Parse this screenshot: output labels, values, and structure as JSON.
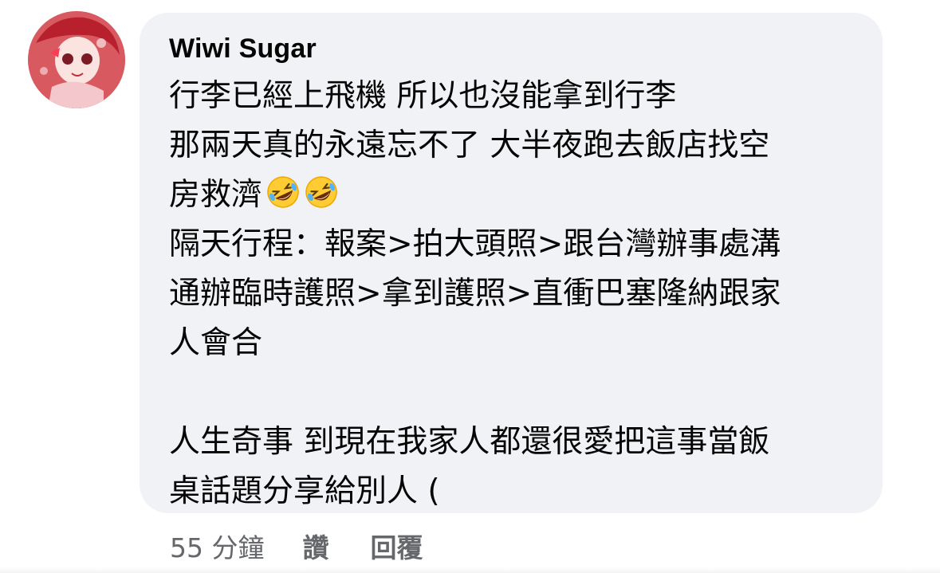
{
  "comment": {
    "author": "Wiwi Sugar",
    "lines": [
      "行李已經上飛機 所以也沒能拿到行李",
      "那兩天真的永遠忘不了 大半夜跑去飯店找空",
      "房救濟",
      "隔天行程：報案>拍大頭照>跟台灣辦事處溝",
      "通辦臨時護照>拿到護照>直衝巴塞隆納跟家",
      "人會合",
      "",
      "人生奇事 到現在我家人都還很愛把這事當飯",
      "桌話題分享給別人 ("
    ],
    "emojis": [
      "rolling-on-floor-laughing-emoji",
      "rolling-on-floor-laughing-emoji"
    ]
  },
  "actions": {
    "time": "55 分鐘",
    "like": "讚",
    "reply": "回覆"
  },
  "colors": {
    "bubble": "#f0f2f5",
    "text": "#050505",
    "meta": "#65676b"
  }
}
